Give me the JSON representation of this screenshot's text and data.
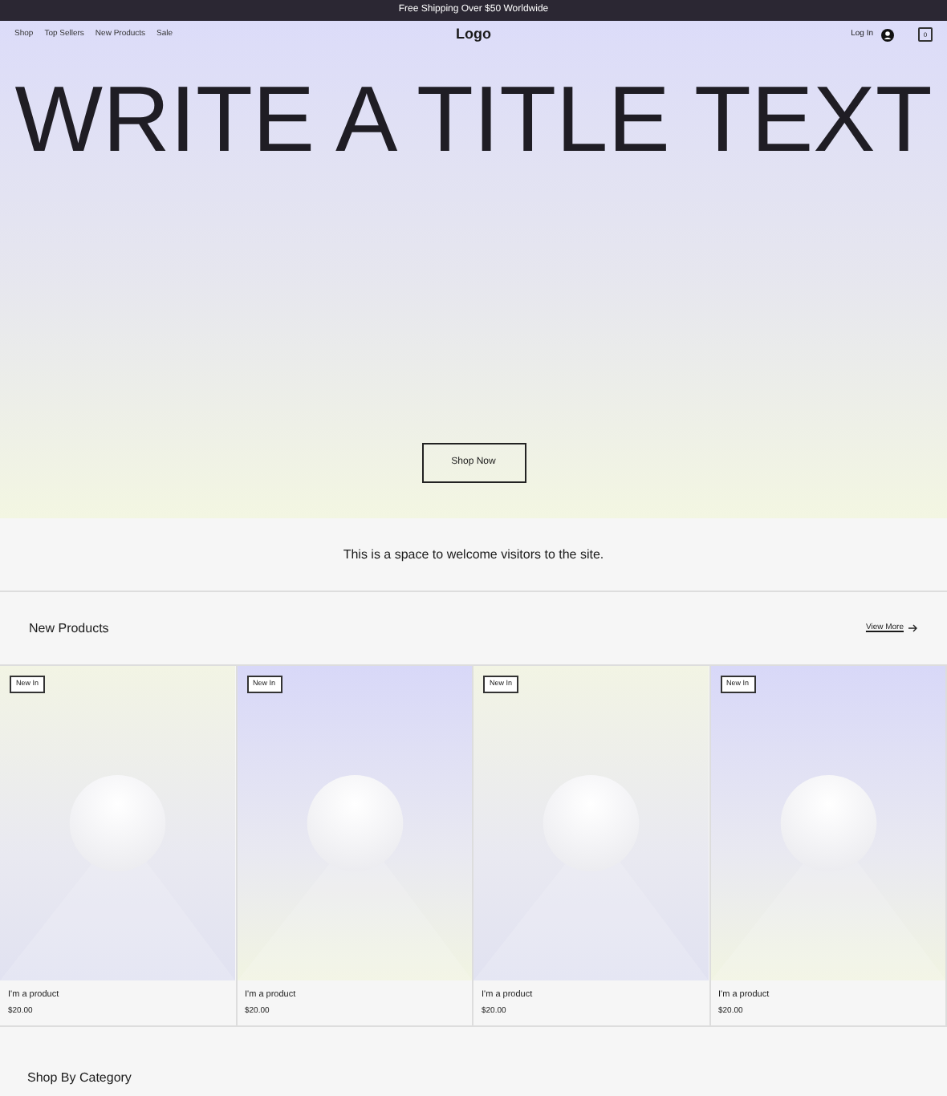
{
  "announcement": "Free Shipping Over $50 Worldwide",
  "nav": {
    "links": [
      "Shop",
      "Top Sellers",
      "New Products",
      "Sale"
    ],
    "logo": "Logo",
    "login": "Log In",
    "cart_count": "0"
  },
  "hero": {
    "title": "WRITE A TITLE TEXT",
    "button": "Shop Now"
  },
  "welcome": "This is a space to welcome visitors to the site.",
  "new_products": {
    "heading": "New Products",
    "view_more": "View More",
    "products": [
      {
        "badge": "New In",
        "name": "I'm a product",
        "price": "$20.00"
      },
      {
        "badge": "New In",
        "name": "I'm a product",
        "price": "$20.00"
      },
      {
        "badge": "New In",
        "name": "I'm a product",
        "price": "$20.00"
      },
      {
        "badge": "New In",
        "name": "I'm a product",
        "price": "$20.00"
      }
    ]
  },
  "category_heading": "Shop By Category"
}
